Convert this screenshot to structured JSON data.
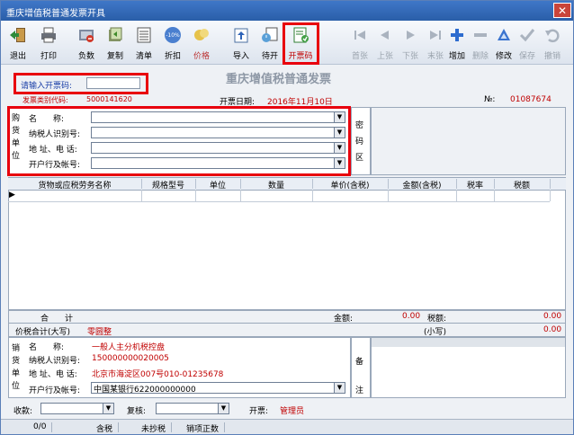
{
  "window": {
    "title": "重庆增值税普通发票开具",
    "close_label": "✕"
  },
  "toolbar": {
    "exit": "退出",
    "print": "打印",
    "negative": "负数",
    "copy": "复制",
    "list": "清单",
    "discount": "折扣",
    "discount_badge": "-10%",
    "price": "价格",
    "import": "导入",
    "pending": "待开",
    "invoice_code": "开票码",
    "first": "首张",
    "prev": "上张",
    "next": "下张",
    "last": "末张",
    "add": "增加",
    "delete": "删除",
    "modify": "修改",
    "save": "保存",
    "cancel": "撤销"
  },
  "invoice": {
    "heading": "重庆增值税普通发票",
    "code_prompt": "请输入开票码:",
    "code_value": "",
    "type_code_label": "发票类别代码:",
    "type_code_value": "5000141620",
    "date_label": "开票日期:",
    "date_value": "2016年11月10日",
    "no_label": "№:",
    "no_value": "01087674"
  },
  "buyer": {
    "side": [
      "购",
      "货",
      "单",
      "位"
    ],
    "name_label": "名　　称:",
    "taxid_label": "纳税人识别号:",
    "address_label": "地 址、电 话:",
    "bank_label": "开户行及帐号:",
    "name_value": "",
    "taxid_value": "",
    "address_value": "",
    "bank_value": ""
  },
  "cipher": {
    "side": [
      "密",
      "码",
      "区"
    ]
  },
  "goods": {
    "columns": [
      "货物或应税劳务名称",
      "规格型号",
      "单位",
      "数量",
      "单价(含税)",
      "金额(含税)",
      "税率",
      "税额"
    ],
    "row_marker": "▶"
  },
  "totals": {
    "sum_label": "合　　计",
    "amount_label": "金额:",
    "amount_value": "0.00",
    "tax_label": "税额:",
    "tax_value": "0.00",
    "total_label": "价税合计(大写)",
    "total_words": "零圆整",
    "small_label": "(小写)",
    "small_value": "0.00"
  },
  "seller": {
    "side": [
      "销",
      "货",
      "单",
      "位"
    ],
    "name_label": "名　　称:",
    "name_value": "一般人主分机税控盘",
    "taxid_label": "纳税人识别号:",
    "taxid_value": "150000000020005",
    "address_label": "地 址、电 话:",
    "address_value": "北京市海淀区007号010-01235678",
    "bank_label": "开户行及帐号:",
    "bank_value": "中国某银行622000000000",
    "remark_side": [
      "备",
      "注"
    ]
  },
  "footer": {
    "payee_label": "收款:",
    "payee_value": "",
    "reviewer_label": "复核:",
    "reviewer_value": "",
    "drawer_label": "开票:",
    "drawer_value": "管理员"
  },
  "status": {
    "count": "0/0",
    "tax_mode": "含税",
    "copy_status": "未抄税",
    "sales_mode": "销项正数"
  },
  "colors": {
    "highlight": "#e8000d",
    "title_bar": "#2a5ea8",
    "red_text": "#c00000"
  }
}
